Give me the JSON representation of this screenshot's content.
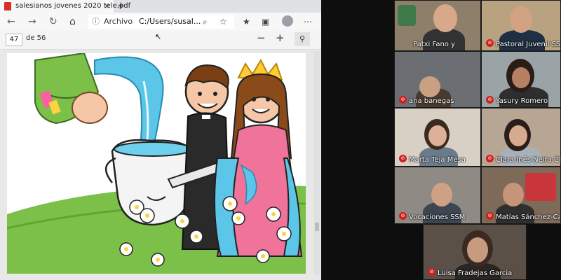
{
  "browser": {
    "tab_title": "salesianos jovenes 2020 tele.pdf",
    "tab_close": "×",
    "new_tab": "+",
    "back": "←",
    "forward": "→",
    "refresh": "↻",
    "home": "⌂",
    "address_info": "ⓘ",
    "address_label": "Archivo",
    "address_path": "C:/Users/susal...",
    "search_glyph": "⌕",
    "star_glyph": "☆",
    "collections_glyph": "★",
    "menu_glyph": "⋯"
  },
  "pdf_toolbar": {
    "page_number": "47",
    "page_of": "de 56",
    "zoom_out": "−",
    "zoom_in": "+",
    "pin": "⚲"
  },
  "participants": [
    {
      "name": "Patxi Fano y",
      "muted": false
    },
    {
      "name": "Pastoral Juvenil SSM",
      "muted": true
    },
    {
      "name": "ana banegas",
      "muted": true
    },
    {
      "name": "Yasury Romero",
      "muted": true
    },
    {
      "name": "Marta Teja Mesa",
      "muted": true
    },
    {
      "name": "Clara Inés Neira Chá",
      "muted": true
    },
    {
      "name": "Vocaciones SSM",
      "muted": true
    },
    {
      "name": "Matías Sánchez-Car",
      "muted": true
    },
    {
      "name": "Luisa Fradejas Garcia",
      "muted": true
    }
  ],
  "colors": {
    "mic_muted": "#d01f1f",
    "water": "#5cc6e8",
    "grass": "#7cc04a"
  }
}
